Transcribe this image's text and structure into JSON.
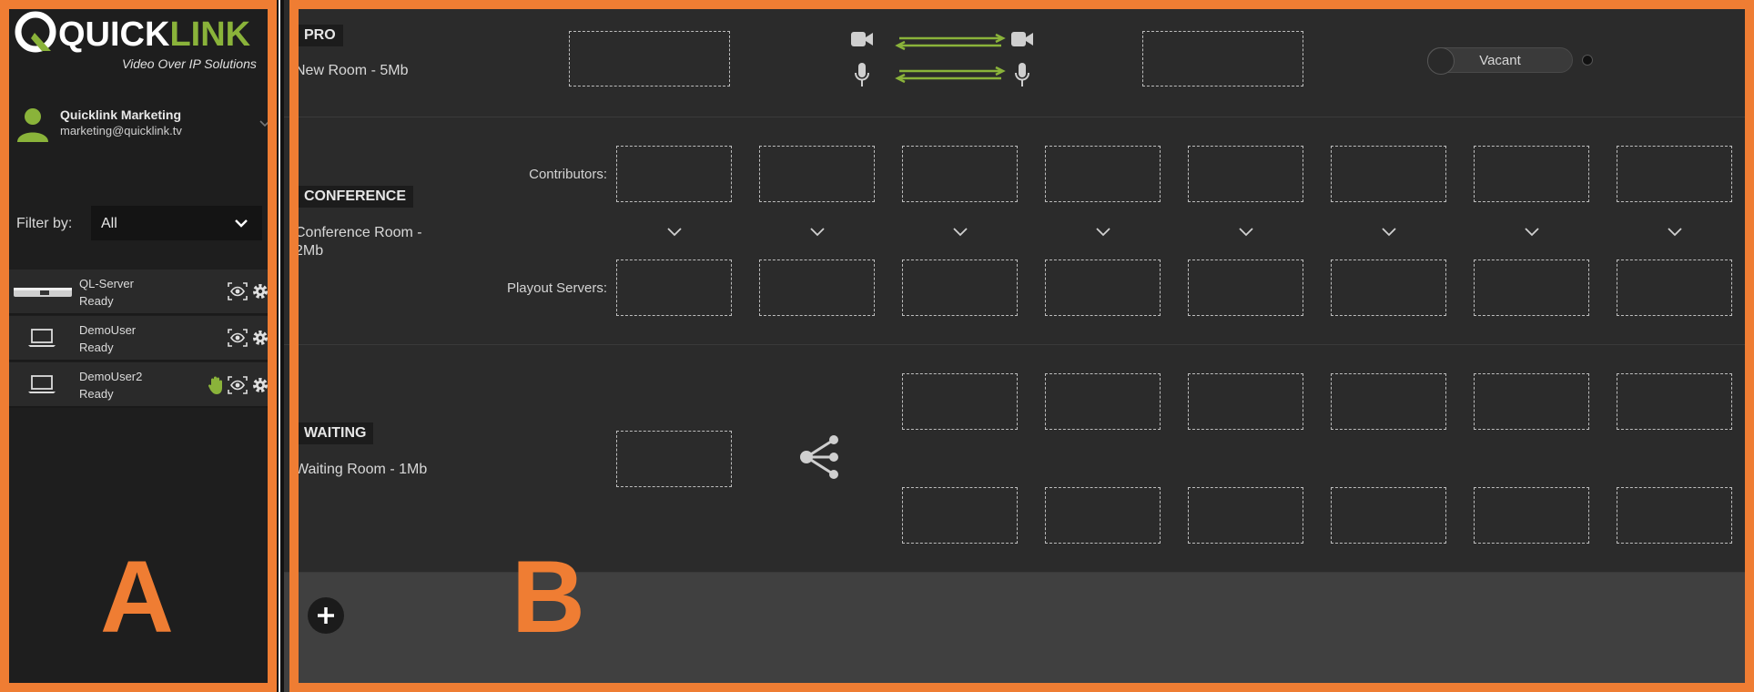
{
  "brand": {
    "logo_prefix": "QUICK",
    "logo_suffix": "LINK",
    "tagline": "Video Over IP Solutions",
    "accent": "#8ab33a",
    "frame_color": "#ef7d33"
  },
  "user": {
    "name": "Quicklink Marketing",
    "email": "marketing@quicklink.tv"
  },
  "filter": {
    "label": "Filter by:",
    "value": "All"
  },
  "devices": [
    {
      "name": "QL-Server",
      "status": "Ready",
      "icon": "server-icon",
      "hand": false
    },
    {
      "name": "DemoUser",
      "status": "Ready",
      "icon": "laptop-icon",
      "hand": false
    },
    {
      "name": "DemoUser2",
      "status": "Ready",
      "icon": "laptop-icon",
      "hand": true
    }
  ],
  "panel_labels": {
    "a": "A",
    "b": "B"
  },
  "rooms": {
    "pro": {
      "badge": "PRO",
      "desc": "New Room - 5Mb",
      "toggle_label": "Vacant"
    },
    "conference": {
      "badge": "CONFERENCE",
      "desc": "Conference Room - 2Mb",
      "contributors_label": "Contributors:",
      "playout_label": "Playout Servers:"
    },
    "waiting": {
      "badge": "WAITING",
      "desc": "Waiting Room - 1Mb"
    }
  }
}
